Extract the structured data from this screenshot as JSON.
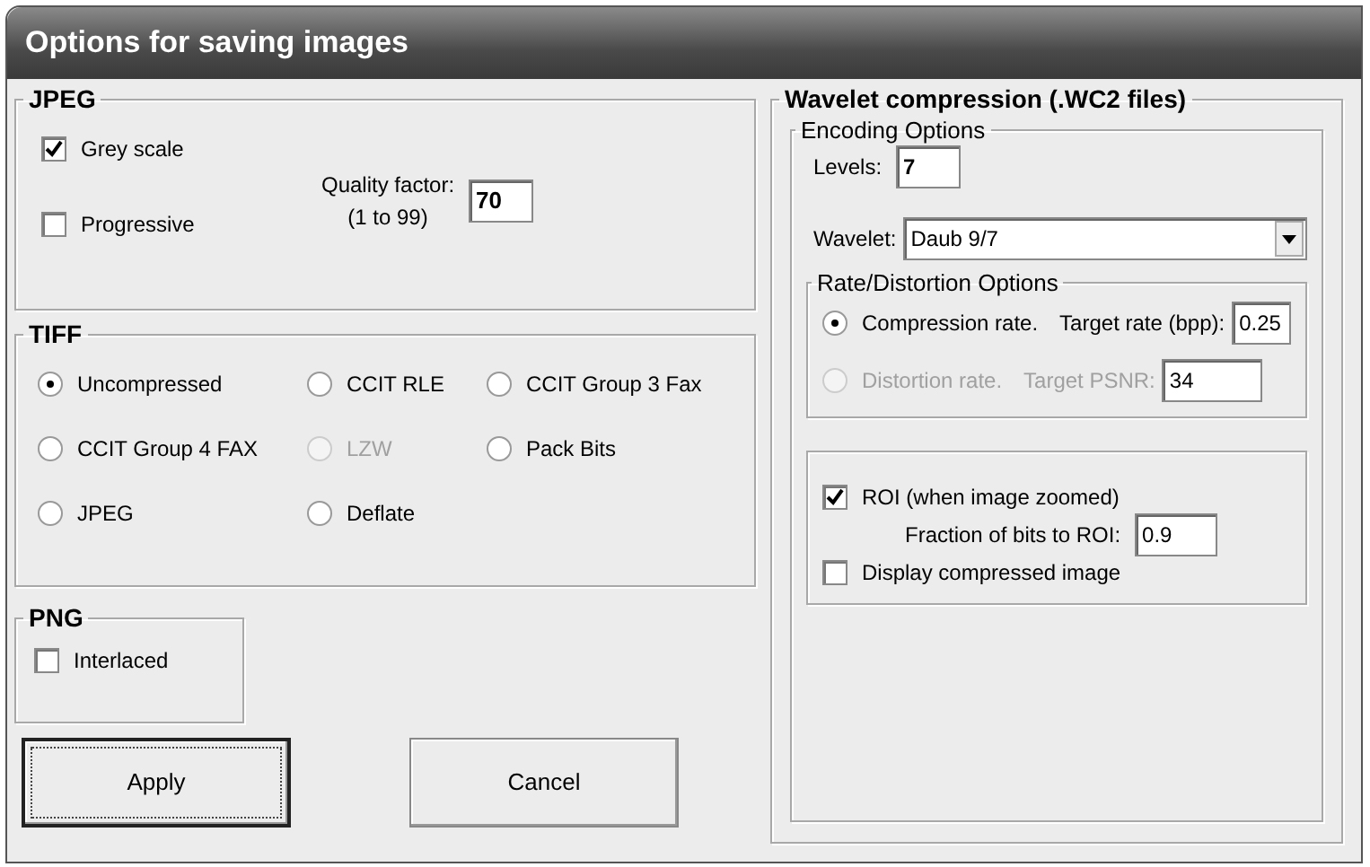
{
  "window": {
    "title": "Options for saving images"
  },
  "jpeg": {
    "title": "JPEG",
    "options": [
      {
        "label": "Grey scale",
        "checked": true
      },
      {
        "label": "Progressive",
        "checked": false
      }
    ],
    "quality": {
      "label": "Quality factor:",
      "hint": "(1 to 99)",
      "value": "70"
    }
  },
  "tiff": {
    "title": "TIFF",
    "options": [
      {
        "label": "Uncompressed",
        "selected": true,
        "disabled": false
      },
      {
        "label": "CCIT RLE",
        "selected": false,
        "disabled": false
      },
      {
        "label": "CCIT Group 3 Fax",
        "selected": false,
        "disabled": false
      },
      {
        "label": "CCIT Group 4 FAX",
        "selected": false,
        "disabled": false
      },
      {
        "label": "LZW",
        "selected": false,
        "disabled": true
      },
      {
        "label": "Pack Bits",
        "selected": false,
        "disabled": false
      },
      {
        "label": "JPEG",
        "selected": false,
        "disabled": false
      },
      {
        "label": "Deflate",
        "selected": false,
        "disabled": false
      }
    ]
  },
  "png": {
    "title": "PNG",
    "options": [
      {
        "label": "Interlaced",
        "checked": false
      }
    ]
  },
  "buttons": [
    {
      "label": "Apply",
      "default": true
    },
    {
      "label": "Cancel",
      "default": false
    }
  ],
  "wavelet": {
    "title": "Wavelet compression (.WC2 files)",
    "encoding": {
      "title": "Encoding Options",
      "levels": {
        "label": "Levels:",
        "value": "7"
      },
      "wavelet": {
        "label": "Wavelet:",
        "value": "Daub 9/7"
      },
      "rate_distortion": {
        "title": "Rate/Distortion Options",
        "options": [
          {
            "label": "Compression rate.",
            "target_label": "Target rate (bpp):",
            "value": "0.25",
            "selected": true,
            "disabled": false
          },
          {
            "label": "Distortion rate.",
            "target_label": "Target PSNR:",
            "value": "34",
            "selected": false,
            "disabled": true
          }
        ]
      },
      "roi": {
        "label": "ROI (when image zoomed)",
        "checked": true,
        "fraction": {
          "label": "Fraction of bits to ROI:",
          "value": "0.9"
        }
      },
      "display_compressed": {
        "label": "Display compressed image",
        "checked": false
      }
    }
  }
}
